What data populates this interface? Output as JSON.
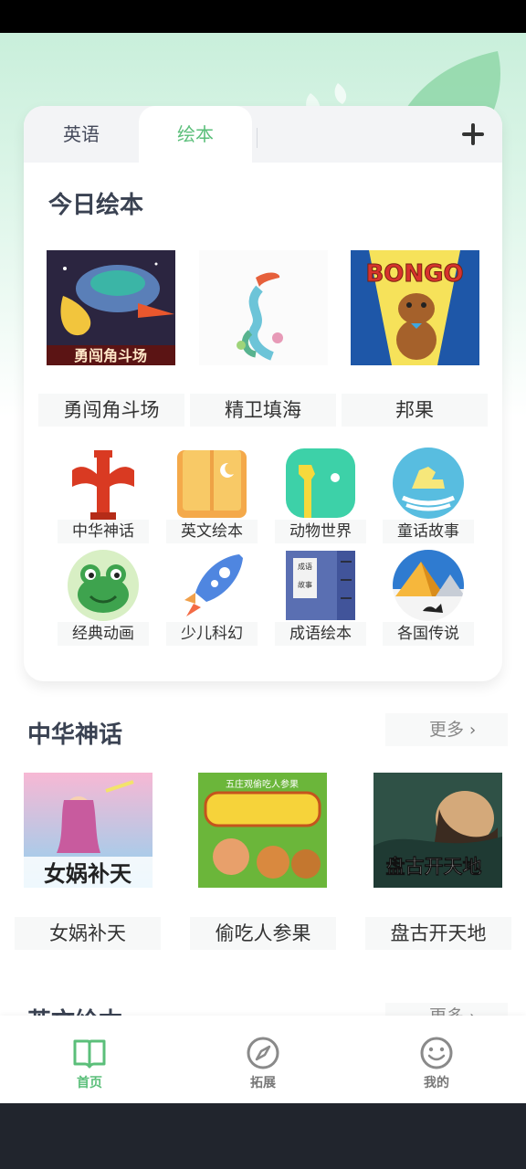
{
  "tabs": {
    "items": [
      {
        "label": "英语",
        "active": false
      },
      {
        "label": "绘本",
        "active": true
      }
    ],
    "add_icon": "plus-icon"
  },
  "today": {
    "title": "今日绘本",
    "books": [
      {
        "title": "勇闯角斗场",
        "cover_text": "勇闯角斗场"
      },
      {
        "title": "精卫填海"
      },
      {
        "title": "邦果",
        "cover_text": "BONGO"
      }
    ]
  },
  "categories": [
    {
      "label": "中华神话",
      "icon": "pillar-icon"
    },
    {
      "label": "英文绘本",
      "icon": "open-book-icon"
    },
    {
      "label": "动物世界",
      "icon": "giraffe-icon"
    },
    {
      "label": "童话故事",
      "icon": "rocking-horse-icon"
    },
    {
      "label": "经典动画",
      "icon": "frog-icon"
    },
    {
      "label": "少儿科幻",
      "icon": "rocket-icon"
    },
    {
      "label": "成语绘本",
      "icon": "idiom-book-icon",
      "cover_text": "成语故事"
    },
    {
      "label": "各国传说",
      "icon": "pyramid-icon"
    }
  ],
  "sections": [
    {
      "title": "中华神话",
      "more": "更多",
      "books": [
        {
          "title": "女娲补天",
          "cover_text": "女娲补天"
        },
        {
          "title": "偷吃人参果",
          "cover_text": "五庄观偷吃人参果"
        },
        {
          "title": "盘古开天地",
          "cover_text": "盘古开天地"
        }
      ]
    },
    {
      "title": "英文绘本",
      "more": "更多"
    }
  ],
  "nav": [
    {
      "label": "首页",
      "icon": "book-icon",
      "active": true
    },
    {
      "label": "拓展",
      "icon": "compass-icon",
      "active": false
    },
    {
      "label": "我的",
      "icon": "smiley-icon",
      "active": false
    }
  ],
  "colors": {
    "accent": "#5bbf7a",
    "title": "#3a4252",
    "status_bar": "#000000",
    "system_bar": "#21252d"
  }
}
